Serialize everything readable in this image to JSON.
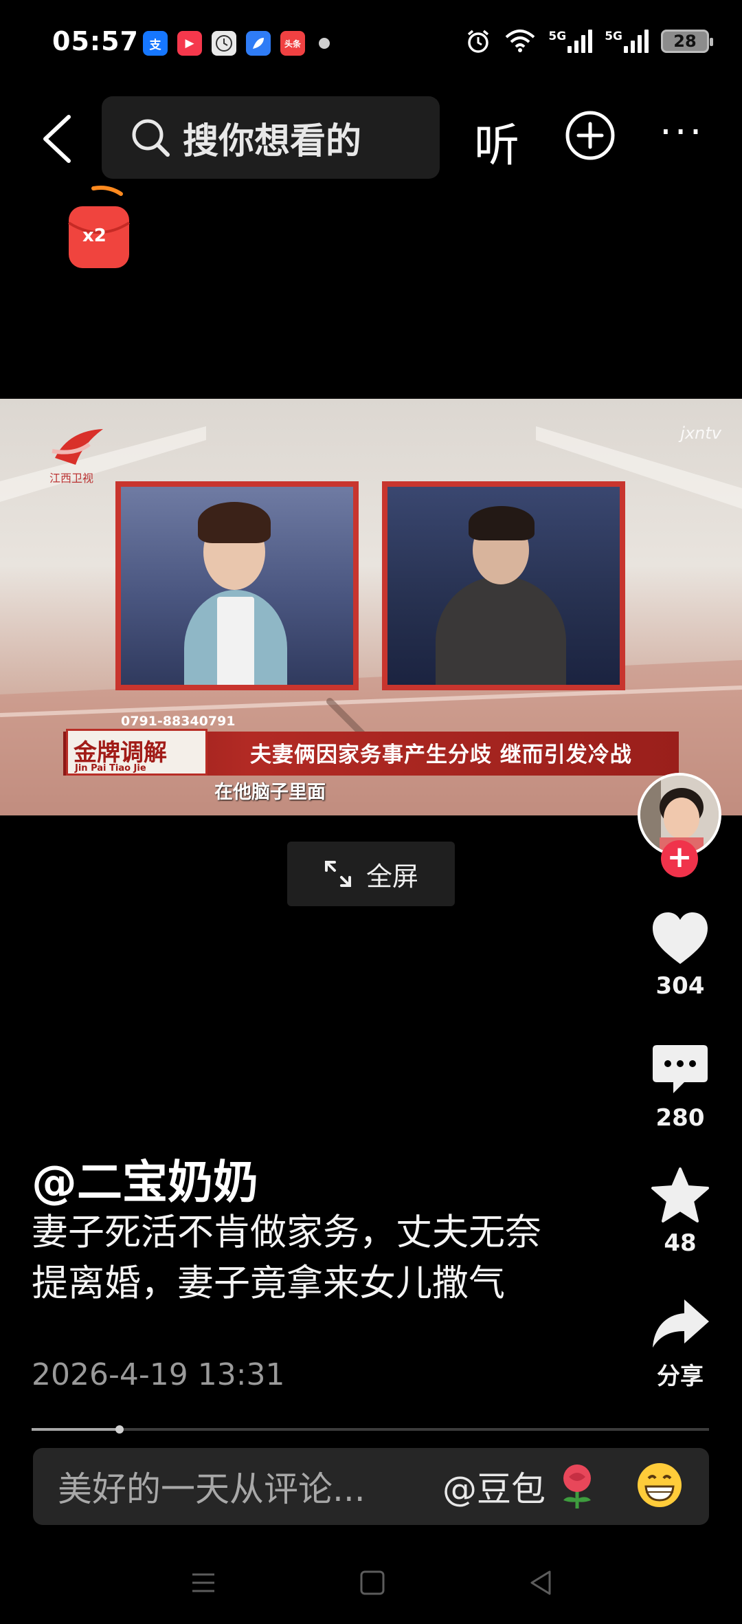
{
  "status_bar": {
    "time": "05:57",
    "apps": [
      {
        "icon": "alipay-icon",
        "label": "支",
        "color": "#1677ff"
      },
      {
        "icon": "video-app-icon",
        "label": "▶",
        "color": "#f5384c"
      },
      {
        "icon": "clock-app-icon",
        "label": "",
        "color": "#e9e9e9"
      },
      {
        "icon": "feather-app-icon",
        "label": "",
        "color": "#2f7cf6"
      },
      {
        "icon": "toutiao-icon",
        "label": "头条",
        "color": "#f04142"
      }
    ],
    "signal_1": "5G",
    "signal_2": "5G",
    "battery": "28"
  },
  "top_bar": {
    "search_placeholder": "搜你想看的",
    "listen_label": "听",
    "more_label": "···"
  },
  "red_packet": {
    "label": "x2"
  },
  "video": {
    "watermark": "jxntv",
    "logo_text": "江西卫视",
    "phone": "0791-88340791",
    "brand": "金牌调解",
    "brand_sub": "Jin Pai    Tiao Jie",
    "caption": "夫妻俩因家务事产生分歧  继而引发冷战",
    "subtitle": "在他脑子里面"
  },
  "fullscreen": {
    "label": "全屏"
  },
  "rail": {
    "likes": "304",
    "comments": "280",
    "favorites": "48",
    "share_label": "分享"
  },
  "post": {
    "author": "@二宝奶奶",
    "description": "妻子死活不肯做家务，丈夫无奈提离婚，妻子竟拿来女儿撒气",
    "date": "2026-4-19 13:31",
    "progress": 0.13
  },
  "comment_bar": {
    "placeholder": "美好的一天从评论...",
    "mention": "@豆包"
  },
  "colors": {
    "accent_red": "#f0334b",
    "background": "#000000"
  }
}
